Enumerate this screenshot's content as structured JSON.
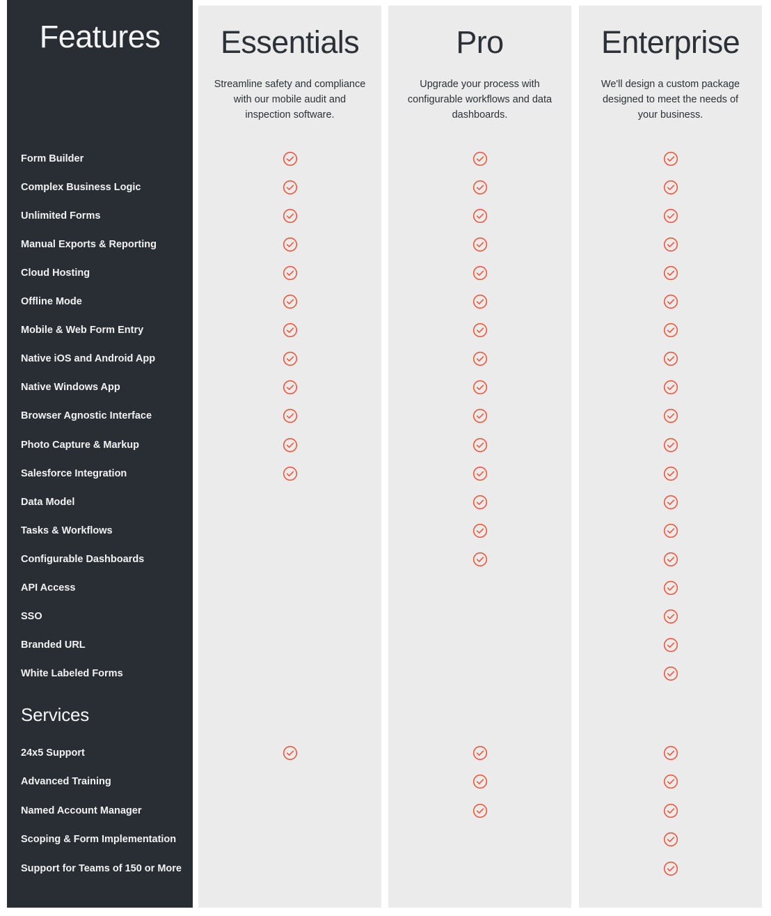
{
  "colors": {
    "sidebar_bg": "#282e33",
    "card_bg": "#ebebeb",
    "page_bg": "#ffffff",
    "check_accent": "#f0573c",
    "sidebar_text": "#f2f2f2",
    "card_text": "#2b3137"
  },
  "features_column": {
    "title": "Features",
    "services_heading": "Services"
  },
  "plans": [
    {
      "id": "essentials",
      "name": "Essentials",
      "description": "Streamline safety and compliance with our mobile audit and inspection software."
    },
    {
      "id": "pro",
      "name": "Pro",
      "description": "Upgrade your process with configurable workflows and data dashboards."
    },
    {
      "id": "enterprise",
      "name": "Enterprise",
      "description": "We'll design a custom package designed to meet the needs of your business."
    }
  ],
  "feature_rows": [
    {
      "label": "Form Builder",
      "essentials": true,
      "pro": true,
      "enterprise": true
    },
    {
      "label": "Complex Business Logic",
      "essentials": true,
      "pro": true,
      "enterprise": true
    },
    {
      "label": "Unlimited Forms",
      "essentials": true,
      "pro": true,
      "enterprise": true
    },
    {
      "label": "Manual Exports & Reporting",
      "essentials": true,
      "pro": true,
      "enterprise": true
    },
    {
      "label": "Cloud Hosting",
      "essentials": true,
      "pro": true,
      "enterprise": true
    },
    {
      "label": "Offline Mode",
      "essentials": true,
      "pro": true,
      "enterprise": true
    },
    {
      "label": "Mobile & Web Form Entry",
      "essentials": true,
      "pro": true,
      "enterprise": true
    },
    {
      "label": "Native iOS and Android App",
      "essentials": true,
      "pro": true,
      "enterprise": true
    },
    {
      "label": "Native Windows App",
      "essentials": true,
      "pro": true,
      "enterprise": true
    },
    {
      "label": "Browser Agnostic Interface",
      "essentials": true,
      "pro": true,
      "enterprise": true
    },
    {
      "label": "Photo Capture & Markup",
      "essentials": true,
      "pro": true,
      "enterprise": true
    },
    {
      "label": "Salesforce Integration",
      "essentials": true,
      "pro": true,
      "enterprise": true
    },
    {
      "label": "Data Model",
      "essentials": false,
      "pro": true,
      "enterprise": true
    },
    {
      "label": "Tasks & Workflows",
      "essentials": false,
      "pro": true,
      "enterprise": true
    },
    {
      "label": "Configurable Dashboards",
      "essentials": false,
      "pro": true,
      "enterprise": true
    },
    {
      "label": "API Access",
      "essentials": false,
      "pro": false,
      "enterprise": true
    },
    {
      "label": "SSO",
      "essentials": false,
      "pro": false,
      "enterprise": true
    },
    {
      "label": "Branded URL",
      "essentials": false,
      "pro": false,
      "enterprise": true
    },
    {
      "label": "White Labeled Forms",
      "essentials": false,
      "pro": false,
      "enterprise": true
    }
  ],
  "service_rows": [
    {
      "label": "24x5 Support",
      "essentials": true,
      "pro": true,
      "enterprise": true
    },
    {
      "label": "Advanced Training",
      "essentials": false,
      "pro": true,
      "enterprise": true
    },
    {
      "label": "Named Account Manager",
      "essentials": false,
      "pro": true,
      "enterprise": true
    },
    {
      "label": "Scoping & Form Implementation",
      "essentials": false,
      "pro": false,
      "enterprise": true
    },
    {
      "label": "Support for Teams of 150 or More",
      "essentials": false,
      "pro": false,
      "enterprise": true
    }
  ],
  "icons": {
    "check": "check-circle-icon"
  }
}
